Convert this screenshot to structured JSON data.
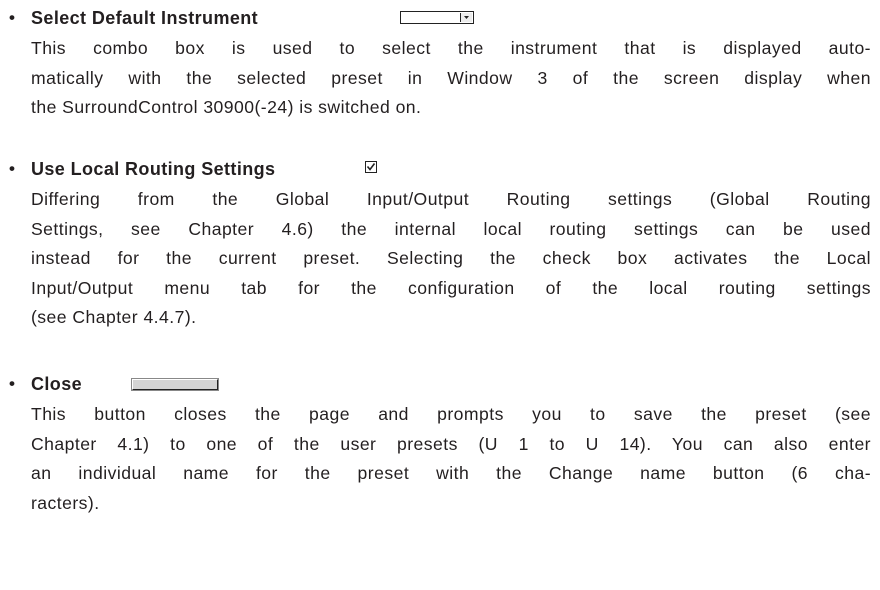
{
  "sections": [
    {
      "bullet": "•",
      "heading": "Select Default Instrument",
      "widget": "combo-box",
      "lines": [
        "This combo box is used to select the instrument that is displayed auto-",
        "matically with the selected preset in Window 3 of the screen display when",
        "the SurroundControl 30900(-24) is switched on."
      ]
    },
    {
      "bullet": "•",
      "heading": "Use Local Routing Settings",
      "widget": "check-box",
      "checked": true,
      "lines": [
        "Differing from the Global Input/Output Routing settings (Global Routing",
        "Settings, see Chapter 4.6) the internal local routing settings can be used",
        "instead for the current preset. Selecting the check box activates the Local",
        "Input/Output menu tab for the configuration of the local routing settings",
        "(see Chapter 4.4.7)."
      ]
    },
    {
      "bullet": "•",
      "heading": "Close",
      "widget": "button",
      "lines": [
        "This button closes the page and prompts you to save the preset (see",
        "Chapter 4.1) to one of the user presets (U 1 to U 14).  You can also enter",
        "an individual name for the preset with the Change name button (6 cha-",
        "racters)."
      ]
    }
  ]
}
